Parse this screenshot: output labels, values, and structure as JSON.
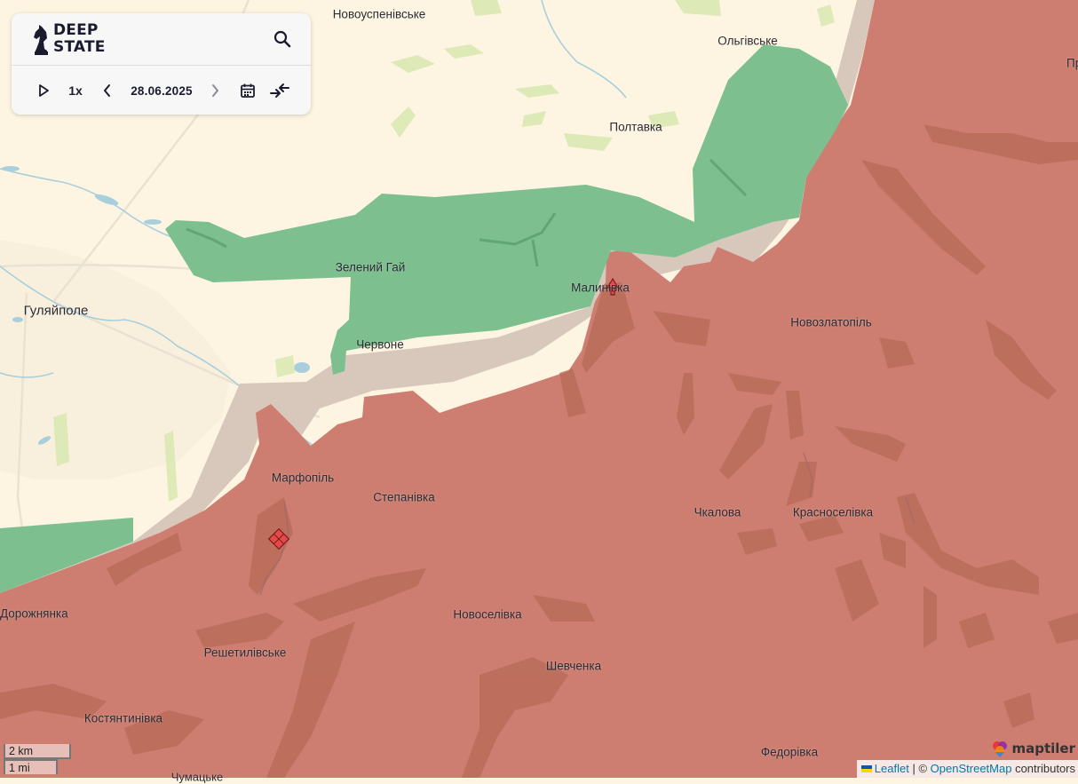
{
  "header": {
    "logo_text_line1": "DEEP",
    "logo_text_line2": "STATE",
    "search_icon": "search-icon"
  },
  "controls": {
    "play_icon": "play-icon",
    "speed": "1x",
    "prev_icon": "chevron-left-icon",
    "date": "28.06.2025",
    "next_icon": "chevron-right-icon",
    "calendar_icon": "calendar-icon",
    "compare_icon": "compare-arrows-icon"
  },
  "colors": {
    "land": "#fdf5e1",
    "occupied": "#cd7e71",
    "liberated": "#7dbf8e",
    "contested": "#d8c8bc",
    "water": "#a9cfdc",
    "fields": "#d8e8b0",
    "ravines": "#b86a57"
  },
  "places": [
    {
      "id": "novouspenivske",
      "name": "Новоуспенівське"
    },
    {
      "id": "olhivske",
      "name": "Ольгівське"
    },
    {
      "id": "poltavka",
      "name": "Полтавка"
    },
    {
      "id": "zelenyi-hai",
      "name": "Зелений Гай"
    },
    {
      "id": "malynivka",
      "name": "Малинівка"
    },
    {
      "id": "huliaipole",
      "name": "Гуляйполе"
    },
    {
      "id": "novozlatopil",
      "name": "Новозлатопіль"
    },
    {
      "id": "chervone",
      "name": "Червоне"
    },
    {
      "id": "marfopil",
      "name": "Марфопіль"
    },
    {
      "id": "stepanivka",
      "name": "Степанівка"
    },
    {
      "id": "chkalova",
      "name": "Чкалова"
    },
    {
      "id": "krasnoselivka",
      "name": "Красноселівка"
    },
    {
      "id": "dorozhnianka",
      "name": "Дорожнянка"
    },
    {
      "id": "novoselivka",
      "name": "Новоселівка"
    },
    {
      "id": "reshetylivske",
      "name": "Решетилівське"
    },
    {
      "id": "shevchenka",
      "name": "Шевченка"
    },
    {
      "id": "kostiantynivka",
      "name": "Костянтинівка"
    },
    {
      "id": "fedorivka",
      "name": "Федорівка"
    },
    {
      "id": "chumatske",
      "name": "Чумацьке"
    },
    {
      "id": "edge-pr",
      "name": "Пр"
    }
  ],
  "markers": [
    {
      "id": "attack-arrow",
      "icon": "attack-arrow-icon"
    },
    {
      "id": "fortification",
      "icon": "fortification-diamond-icon"
    }
  ],
  "scale": {
    "km": "2 km",
    "mi": "1 mi"
  },
  "attribution": {
    "leaflet": "Leaflet",
    "separator": "| ©",
    "osm": "OpenStreetMap",
    "contributors": "contributors"
  },
  "maptiler": {
    "text": "maptiler"
  }
}
